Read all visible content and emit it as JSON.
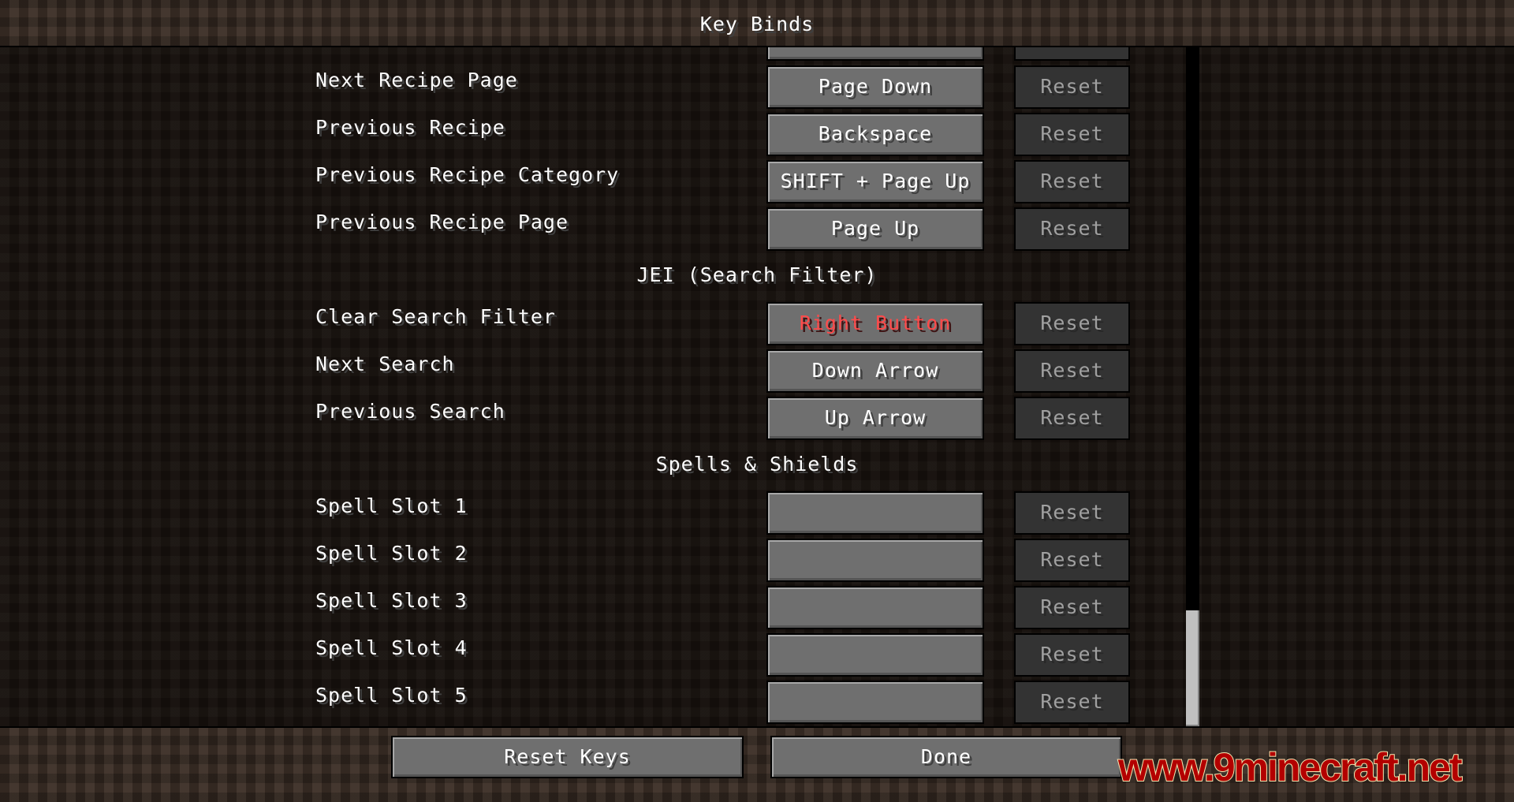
{
  "header": {
    "title": "Key Binds"
  },
  "rows": [
    {
      "label": "Next Recipe Page",
      "key": "Page Down",
      "reset": "Reset"
    },
    {
      "label": "Previous Recipe",
      "key": "Backspace",
      "reset": "Reset"
    },
    {
      "label": "Previous Recipe Category",
      "key": "SHIFT + Page Up",
      "reset": "Reset"
    },
    {
      "label": "Previous Recipe Page",
      "key": "Page Up",
      "reset": "Reset"
    },
    {
      "label": "Clear Search Filter",
      "key": "Right Button",
      "reset": "Reset",
      "conflict": true
    },
    {
      "label": "Next Search",
      "key": "Down Arrow",
      "reset": "Reset"
    },
    {
      "label": "Previous Search",
      "key": "Up Arrow",
      "reset": "Reset"
    },
    {
      "label": "Spell Slot 1",
      "key": "",
      "reset": "Reset"
    },
    {
      "label": "Spell Slot 2",
      "key": "",
      "reset": "Reset"
    },
    {
      "label": "Spell Slot 3",
      "key": "",
      "reset": "Reset"
    },
    {
      "label": "Spell Slot 4",
      "key": "",
      "reset": "Reset"
    },
    {
      "label": "Spell Slot 5",
      "key": "",
      "reset": "Reset"
    }
  ],
  "categories": [
    "JEI (Search Filter)",
    "Spells & Shields"
  ],
  "footer": {
    "reset_keys": "Reset Keys",
    "done": "Done"
  },
  "watermark": "www.9minecraft.net",
  "colors": {
    "conflict": "#ff4a4a",
    "button": "#6f6f6f",
    "reset_disabled": "#333333"
  },
  "scroll": {
    "position_fraction": 1.0
  }
}
